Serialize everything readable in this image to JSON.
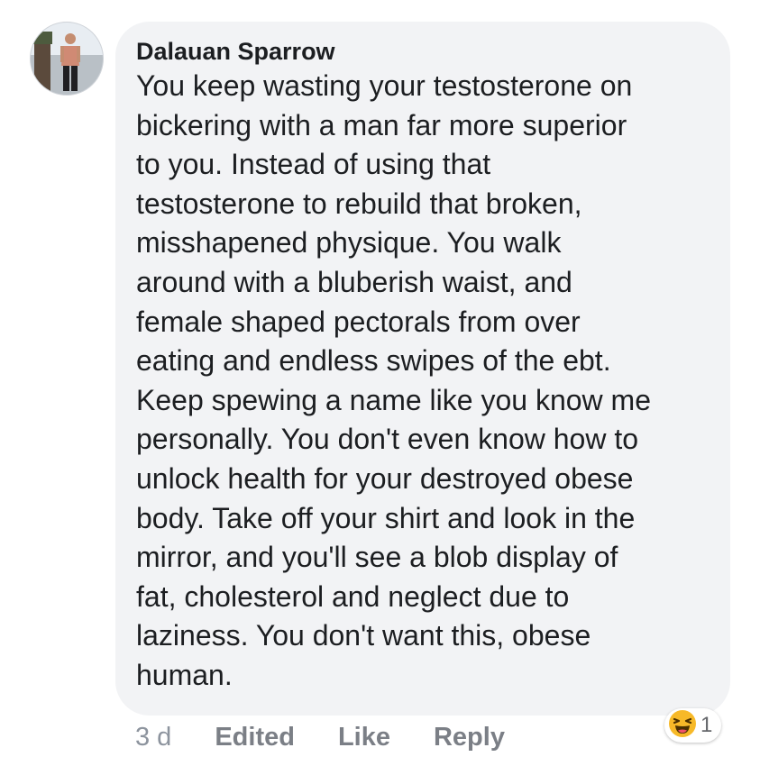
{
  "comment": {
    "author": "Dalauan Sparrow",
    "text": "You keep wasting your testosterone on\nbickering with a man far more superior\nto you. Instead of using that\ntestosterone to rebuild that broken,\nmisshapened physique. You walk\naround with a bluberish waist, and\nfemale shaped pectorals from over\neating and endless swipes of the ebt.\nKeep spewing a name like you know me\npersonally. You don't even know how to\nunlock health for your destroyed obese\nbody. Take off your shirt and look in the\nmirror, and you'll see a blob display of\nfat, cholesterol and neglect due to\nlaziness. You don't want this, obese\nhuman.",
    "timestamp": "3 d",
    "edited_label": "Edited",
    "like_label": "Like",
    "reply_label": "Reply",
    "reaction": {
      "icon": "laughing-emoji-icon",
      "count": "1",
      "color": "#f7b928"
    }
  },
  "colors": {
    "bubble": "#f2f3f5",
    "text": "#1c1e21",
    "muted": "#65676b"
  }
}
